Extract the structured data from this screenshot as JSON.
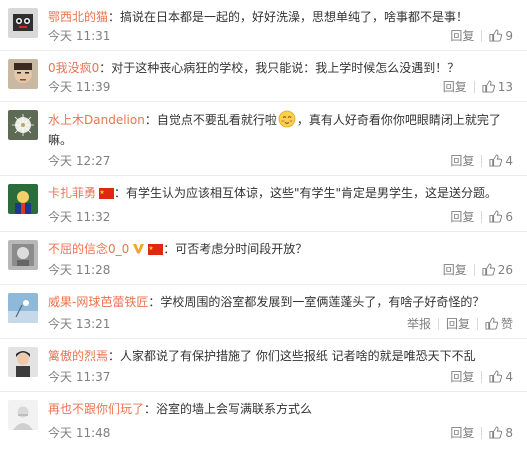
{
  "comments": [
    {
      "name": "鄂西北的猫",
      "badge": "",
      "text": "：搞说在日本都是一起的，好好洗澡，思想单纯了，啥事都不是事！",
      "time": "今天 11:31",
      "actions": [
        "回复"
      ],
      "likes": "9"
    },
    {
      "name": "0我没疯0",
      "badge": "",
      "text": "：对于这种丧心病狂的学校，我只能说：我上学时候怎么没遇到！？",
      "time": "今天 11:39",
      "actions": [
        "回复"
      ],
      "likes": "13"
    },
    {
      "name": "水上木Dandelion",
      "badge": "",
      "text_before": "：自觉点不要乱看就行啦",
      "text_after": "，真有人好奇看你你吧眼睛闭上就完了嘛。",
      "time": "今天 12:27",
      "actions": [
        "回复"
      ],
      "likes": "4"
    },
    {
      "name": "卡扎菲勇",
      "badge": "flag",
      "text": "：有学生认为应该相互体谅，这些\"有学生\"肯定是男学生，这是送分题。",
      "time": "今天 11:32",
      "actions": [
        "回复"
      ],
      "likes": "6"
    },
    {
      "name": "不屈的信念0_0",
      "badge": "v-flag",
      "text": "：可否考虑分时间段开放？",
      "time": "今天 11:28",
      "actions": [
        "回复"
      ],
      "likes": "26"
    },
    {
      "name": "威果-网球芭蕾铁匠",
      "badge": "",
      "text": "：学校周围的浴室都发展到一室俩莲蓬头了，有啥子好奇怪的？",
      "time": "今天 13:21",
      "actions": [
        "举报",
        "回复"
      ],
      "likes": "赞"
    },
    {
      "name": "篱傲的烈焉",
      "badge": "",
      "text": "：人家都说了有保护措施了 你们这些报纸 记者啥的就是唯恐天下不乱",
      "time": "今天 11:37",
      "actions": [
        "回复"
      ],
      "likes": "4"
    },
    {
      "name": "再也不跟你们玩了",
      "badge": "",
      "text": "：浴室的墙上会写满联系方式么",
      "time": "今天 11:48",
      "actions": [
        "回复"
      ],
      "likes": "8"
    }
  ],
  "colors": {
    "name": "#eb7350",
    "meta": "#808080",
    "text": "#333333"
  }
}
